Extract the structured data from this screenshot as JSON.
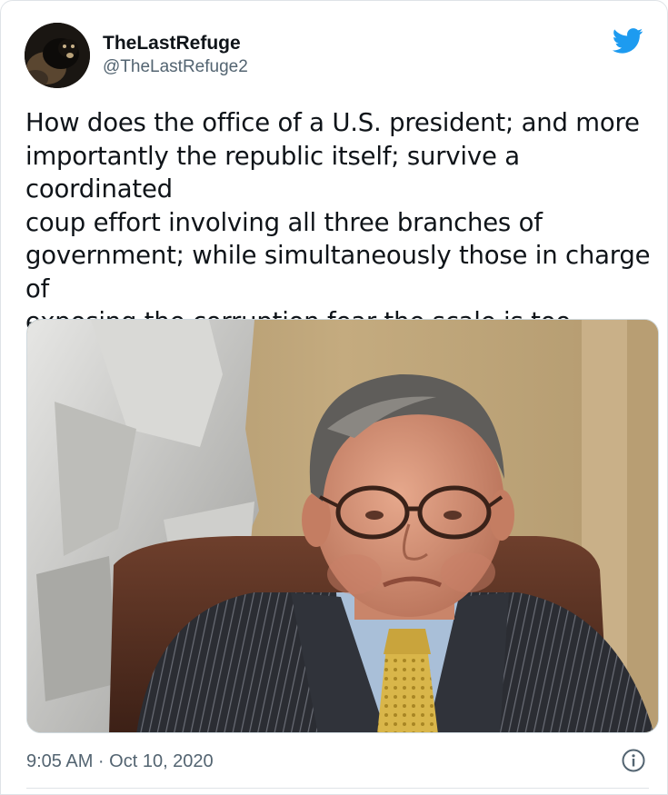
{
  "tweet": {
    "author": {
      "display_name": "TheLastRefuge",
      "handle": "@TheLastRefuge2",
      "avatar_icon": "avatar-photo"
    },
    "platform_icon": "twitter-bird-icon",
    "text": "How does the office of a U.S. president; and more\nimportantly the republic itself; survive a coordinated\ncoup effort involving all three branches of\ngovernment; while simultaneously those in charge of\nexposing the corruption fear the scale is too\ndamaging for them to reveal?",
    "timestamp": "9:05 AM · Oct 10, 2020",
    "info_icon": "info-icon"
  },
  "colors": {
    "text_primary": "#0f1419",
    "text_secondary": "#536471",
    "twitter_blue": "#1d9bf0",
    "border": "#dfe3e7"
  }
}
